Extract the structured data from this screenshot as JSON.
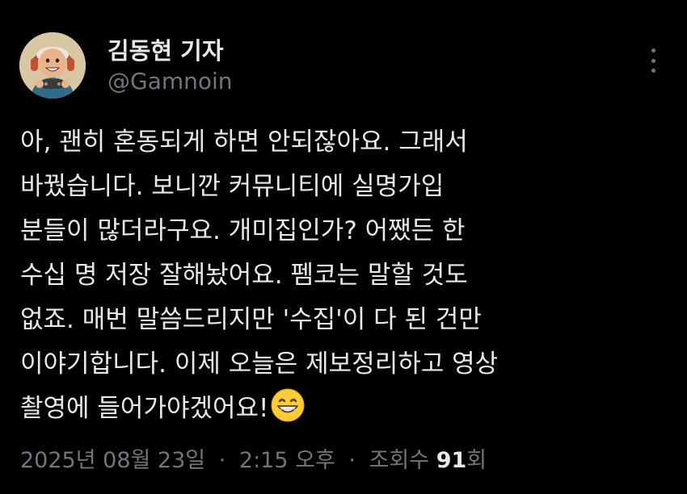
{
  "author": {
    "display_name": "김동현 기자",
    "handle": "@Gamnoin",
    "avatar_icon": "avatar-cartoon-gamer-icon"
  },
  "menu": {
    "icon": "more-vertical-icon"
  },
  "post": {
    "lines": [
      "아, 괜히 혼동되게 하면 안되잖아요. 그래서",
      "바꿨습니다. 보니깐 커뮤니티에 실명가입",
      "분들이 많더라구요. 개미집인가? 어쨌든 한",
      "수십 명 저장 잘해놨어요. 펨코는 말할 것도",
      "없죠. 매번 말씀드리지만 '수집'이 다 된 건만",
      "이야기합니다. 이제 오늘은 제보정리하고 영상",
      "촬영에 들어가야겠어요!"
    ],
    "emoji_icon": "grinning-face-emoji-icon"
  },
  "meta": {
    "date": "2025년 08월 23일",
    "time": "2:15 오후",
    "views_label": "조회수",
    "views_count": "91",
    "views_suffix": "회",
    "separator": "·"
  },
  "colors": {
    "background": "#000000",
    "primary_text": "#e7e9ea",
    "secondary_text": "#71767b"
  }
}
